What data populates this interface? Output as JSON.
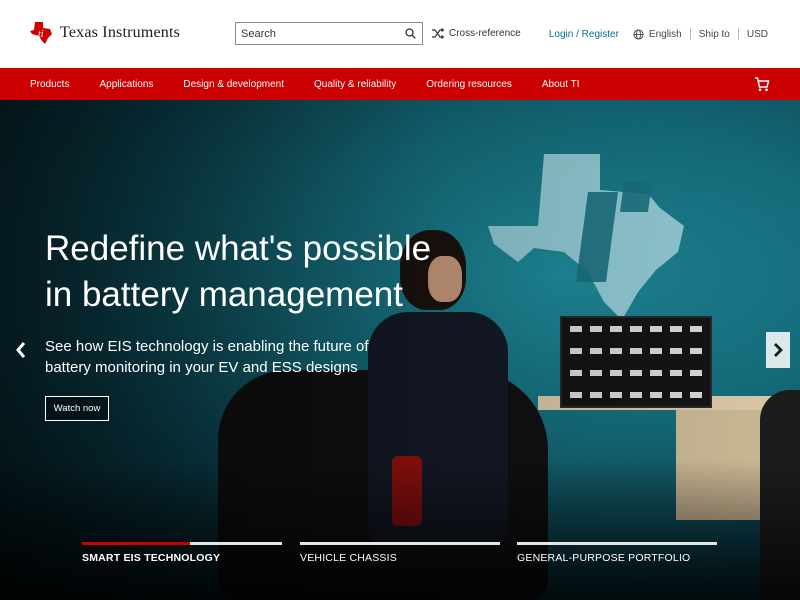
{
  "header": {
    "brand": {
      "logo_text": "Texas Instruments"
    },
    "search": {
      "placeholder": "Search"
    },
    "cross_reference": "Cross-reference",
    "login": "Login / Register",
    "language": "English",
    "ship_to": "Ship to",
    "currency": "USD"
  },
  "nav": {
    "items": [
      "Products",
      "Applications",
      "Design & development",
      "Quality & reliability",
      "Ordering resources",
      "About TI"
    ]
  },
  "hero": {
    "headline_line1": "Redefine what's possible",
    "headline_line2": "in battery management",
    "subtext_line1": "See how EIS technology is enabling the future of",
    "subtext_line2": "battery monitoring in your EV and ESS designs",
    "cta": "Watch now"
  },
  "carousel": {
    "tabs": [
      {
        "label": "SMART EIS TECHNOLOGY",
        "progress": 0.54,
        "active": true
      },
      {
        "label": "VEHICLE CHASSIS",
        "progress": 0,
        "active": false
      },
      {
        "label": "GENERAL-PURPOSE PORTFOLIO",
        "progress": 0,
        "active": false
      }
    ]
  },
  "icons": {
    "search": "search-icon",
    "cross_reference": "shuffle-icon",
    "language": "globe-icon",
    "cart": "cart-icon",
    "prev": "chevron-left-icon",
    "next": "chevron-right-icon"
  },
  "colors": {
    "brand_red": "#cc0000",
    "link_teal": "#00718f",
    "hero_teal": "#146b7a"
  }
}
